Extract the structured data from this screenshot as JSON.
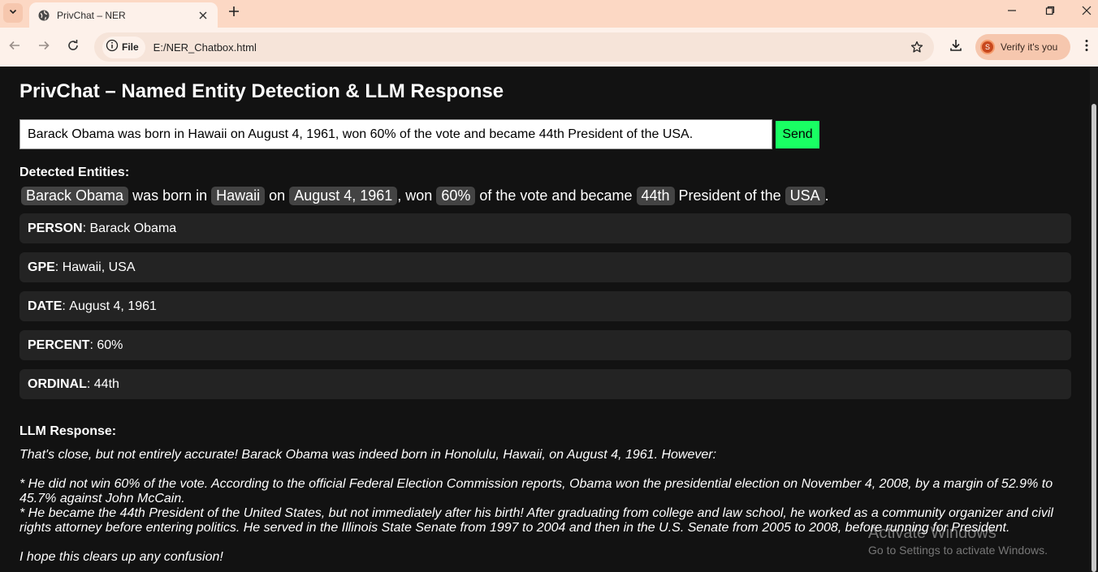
{
  "browser": {
    "tab_title": "PrivChat – NER",
    "chip_label": "File",
    "url": "E:/NER_Chatbox.html",
    "profile_label": "Verify it's you",
    "profile_initial": "S"
  },
  "page": {
    "title": "PrivChat – Named Entity Detection & LLM Response",
    "input_value": "Barack Obama was born in Hawaii on August 4, 1961, won 60% of the vote and became 44th President of the USA.",
    "send_label": "Send",
    "entities_label": "Detected Entities:",
    "sentence": [
      {
        "text": "Barack Obama",
        "entity": true
      },
      {
        "text": " was born in ",
        "entity": false
      },
      {
        "text": "Hawaii",
        "entity": true
      },
      {
        "text": " on ",
        "entity": false
      },
      {
        "text": "August 4, 1961",
        "entity": true
      },
      {
        "text": ", won ",
        "entity": false
      },
      {
        "text": "60%",
        "entity": true
      },
      {
        "text": " of the vote and became ",
        "entity": false
      },
      {
        "text": "44th",
        "entity": true
      },
      {
        "text": " President of the ",
        "entity": false
      },
      {
        "text": "USA",
        "entity": true
      },
      {
        "text": ".",
        "entity": false
      }
    ],
    "entity_groups": [
      {
        "label": "PERSON",
        "values": "Barack Obama"
      },
      {
        "label": "GPE",
        "values": "Hawaii, USA"
      },
      {
        "label": "DATE",
        "values": "August 4, 1961"
      },
      {
        "label": "PERCENT",
        "values": "60%"
      },
      {
        "label": "ORDINAL",
        "values": "44th"
      }
    ],
    "llm_label": "LLM Response:",
    "llm_response": "That's close, but not entirely accurate! Barack Obama was indeed born in Honolulu, Hawaii, on August 4, 1961. However:\n\n* He did not win 60% of the vote. According to the official Federal Election Commission reports, Obama won the presidential election on November 4, 2008, by a margin of 52.9% to 45.7% against John McCain.\n* He became the 44th President of the United States, but not immediately after his birth! After graduating from college and law school, he worked as a community organizer and civil rights attorney before entering politics. He served in the Illinois State Senate from 1997 to 2004 and then in the U.S. Senate from 2005 to 2008, before running for President.\n\nI hope this clears up any confusion!"
  },
  "watermark": {
    "title": "Activate Windows",
    "subtitle": "Go to Settings to activate Windows."
  },
  "colors": {
    "accent_send": "#19ff63",
    "page_bg": "#121212",
    "entity_highlight": "#434343",
    "card_bg": "#232323",
    "chrome_bg": "#fcd8c4"
  }
}
